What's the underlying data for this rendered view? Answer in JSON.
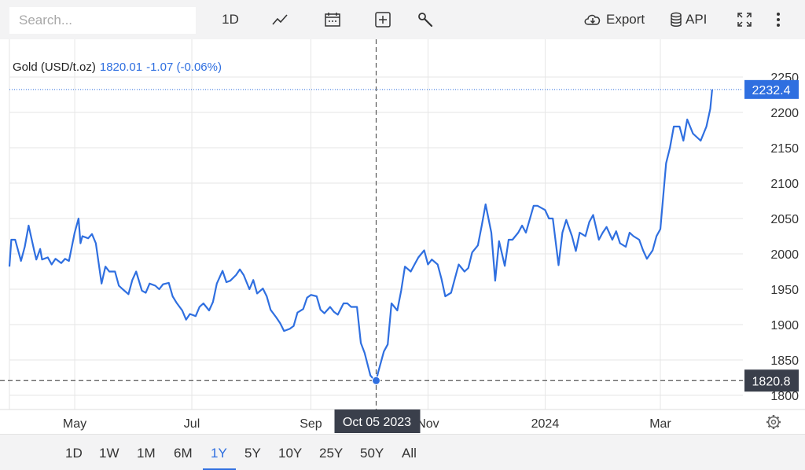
{
  "toolbar": {
    "search_placeholder": "Search...",
    "interval_label": "1D",
    "export_label": "Export",
    "api_label": "API",
    "icons": [
      "line-chart-icon",
      "calendar-icon",
      "crosshair-plus-icon",
      "wrench-icon",
      "cloud-download-icon",
      "database-icon",
      "fullscreen-icon",
      "more-vertical-icon"
    ]
  },
  "quote": {
    "symbol": "Gold (USD/t.oz)",
    "price": "1820.01",
    "change": "-1.07 (-0.06%)"
  },
  "colors": {
    "line": "#2f6fe0",
    "last_price_badge": "#2f6fe0",
    "crosshair_badge": "#3a3f4b",
    "grid": "#e6e6e6",
    "background": "#ffffff"
  },
  "range_buttons": [
    "1D",
    "1W",
    "1M",
    "6M",
    "1Y",
    "5Y",
    "10Y",
    "25Y",
    "50Y",
    "All"
  ],
  "active_range": "1Y",
  "chart_data": {
    "type": "line",
    "title": "",
    "xlabel": "",
    "ylabel": "",
    "ylim": [
      1780,
      2270
    ],
    "y_ticks": [
      1800,
      1850,
      1900,
      1950,
      2000,
      2050,
      2100,
      2150,
      2200,
      2250
    ],
    "x_ticks": [
      {
        "date": "2023-05-01",
        "label": "May"
      },
      {
        "date": "2023-07-01",
        "label": "Jul"
      },
      {
        "date": "2023-09-01",
        "label": "Sep"
      },
      {
        "date": "2023-11-01",
        "label": "Nov"
      },
      {
        "date": "2024-01-01",
        "label": "2024"
      },
      {
        "date": "2024-03-01",
        "label": "Mar"
      }
    ],
    "xlim": [
      "2023-03-28",
      "2024-04-13"
    ],
    "grid": true,
    "last_price_label": "2232.4",
    "crosshair": {
      "date": "2023-10-05",
      "value": 1820.8,
      "date_label": "Oct 05 2023",
      "value_label": "1820.8"
    },
    "series": [
      {
        "x": [
          "2023-03-28",
          "2023-03-29",
          "2023-03-31",
          "2023-04-03",
          "2023-04-05",
          "2023-04-07",
          "2023-04-10",
          "2023-04-11",
          "2023-04-13",
          "2023-04-14",
          "2023-04-17",
          "2023-04-19",
          "2023-04-21",
          "2023-04-24",
          "2023-04-26",
          "2023-04-28",
          "2023-05-01",
          "2023-05-03",
          "2023-05-04",
          "2023-05-05",
          "2023-05-08",
          "2023-05-10",
          "2023-05-12",
          "2023-05-15",
          "2023-05-17",
          "2023-05-19",
          "2023-05-22",
          "2023-05-24",
          "2023-05-26",
          "2023-05-29",
          "2023-05-31",
          "2023-06-02",
          "2023-06-05",
          "2023-06-07",
          "2023-06-09",
          "2023-06-12",
          "2023-06-14",
          "2023-06-16",
          "2023-06-19",
          "2023-06-21",
          "2023-06-23",
          "2023-06-26",
          "2023-06-28",
          "2023-06-30",
          "2023-07-03",
          "2023-07-05",
          "2023-07-07",
          "2023-07-10",
          "2023-07-12",
          "2023-07-14",
          "2023-07-17",
          "2023-07-19",
          "2023-07-21",
          "2023-07-24",
          "2023-07-26",
          "2023-07-28",
          "2023-07-31",
          "2023-08-02",
          "2023-08-04",
          "2023-08-07",
          "2023-08-09",
          "2023-08-11",
          "2023-08-14",
          "2023-08-16",
          "2023-08-18",
          "2023-08-21",
          "2023-08-23",
          "2023-08-25",
          "2023-08-28",
          "2023-08-30",
          "2023-09-01",
          "2023-09-04",
          "2023-09-06",
          "2023-09-08",
          "2023-09-11",
          "2023-09-13",
          "2023-09-15",
          "2023-09-18",
          "2023-09-20",
          "2023-09-22",
          "2023-09-25",
          "2023-09-27",
          "2023-09-29",
          "2023-10-02",
          "2023-10-04",
          "2023-10-05",
          "2023-10-06",
          "2023-10-09",
          "2023-10-11",
          "2023-10-13",
          "2023-10-16",
          "2023-10-18",
          "2023-10-20",
          "2023-10-23",
          "2023-10-25",
          "2023-10-27",
          "2023-10-30",
          "2023-11-01",
          "2023-11-03",
          "2023-11-06",
          "2023-11-08",
          "2023-11-10",
          "2023-11-13",
          "2023-11-15",
          "2023-11-17",
          "2023-11-20",
          "2023-11-22",
          "2023-11-24",
          "2023-11-27",
          "2023-11-29",
          "2023-12-01",
          "2023-12-04",
          "2023-12-06",
          "2023-12-08",
          "2023-12-11",
          "2023-12-13",
          "2023-12-15",
          "2023-12-18",
          "2023-12-20",
          "2023-12-22",
          "2023-12-26",
          "2023-12-28",
          "2024-01-01",
          "2024-01-03",
          "2024-01-05",
          "2024-01-08",
          "2024-01-10",
          "2024-01-12",
          "2024-01-15",
          "2024-01-17",
          "2024-01-19",
          "2024-01-22",
          "2024-01-24",
          "2024-01-26",
          "2024-01-29",
          "2024-01-31",
          "2024-02-02",
          "2024-02-05",
          "2024-02-07",
          "2024-02-09",
          "2024-02-12",
          "2024-02-14",
          "2024-02-16",
          "2024-02-19",
          "2024-02-21",
          "2024-02-23",
          "2024-02-26",
          "2024-02-28",
          "2024-03-01",
          "2024-03-04",
          "2024-03-06",
          "2024-03-08",
          "2024-03-11",
          "2024-03-13",
          "2024-03-15",
          "2024-03-18",
          "2024-03-20",
          "2024-03-22",
          "2024-03-25",
          "2024-03-27",
          "2024-03-28"
        ],
        "y": [
          1982,
          2020,
          2020,
          1990,
          2010,
          2040,
          2003,
          1992,
          2007,
          1992,
          1995,
          1985,
          1993,
          1987,
          1993,
          1990,
          2030,
          2050,
          2015,
          2025,
          2022,
          2028,
          2015,
          1958,
          1982,
          1975,
          1975,
          1955,
          1950,
          1943,
          1963,
          1975,
          1948,
          1945,
          1958,
          1955,
          1950,
          1957,
          1959,
          1940,
          1931,
          1920,
          1907,
          1915,
          1912,
          1925,
          1930,
          1920,
          1932,
          1958,
          1976,
          1960,
          1962,
          1970,
          1978,
          1970,
          1950,
          1963,
          1944,
          1951,
          1940,
          1921,
          1910,
          1902,
          1891,
          1894,
          1898,
          1917,
          1922,
          1938,
          1942,
          1940,
          1921,
          1916,
          1925,
          1918,
          1914,
          1930,
          1930,
          1925,
          1925,
          1874,
          1860,
          1828,
          1822,
          1820.8,
          1832,
          1862,
          1872,
          1930,
          1920,
          1948,
          1982,
          1975,
          1985,
          1995,
          2005,
          1985,
          1992,
          1985,
          1965,
          1940,
          1945,
          1965,
          1985,
          1975,
          1980,
          2002,
          2012,
          2040,
          2070,
          2030,
          1962,
          2018,
          1983,
          2020,
          2020,
          2030,
          2040,
          2030,
          2068,
          2068,
          2062,
          2050,
          2050,
          1984,
          2030,
          2048,
          2025,
          2004,
          2030,
          2025,
          2045,
          2055,
          2020,
          2030,
          2038,
          2020,
          2032,
          2015,
          2010,
          2030,
          2025,
          2020,
          2005,
          1993,
          2005,
          2025,
          2035,
          2128,
          2150,
          2180,
          2180,
          2160,
          2190,
          2170,
          2165,
          2160,
          2180,
          2205,
          2232.4
        ]
      }
    ]
  }
}
